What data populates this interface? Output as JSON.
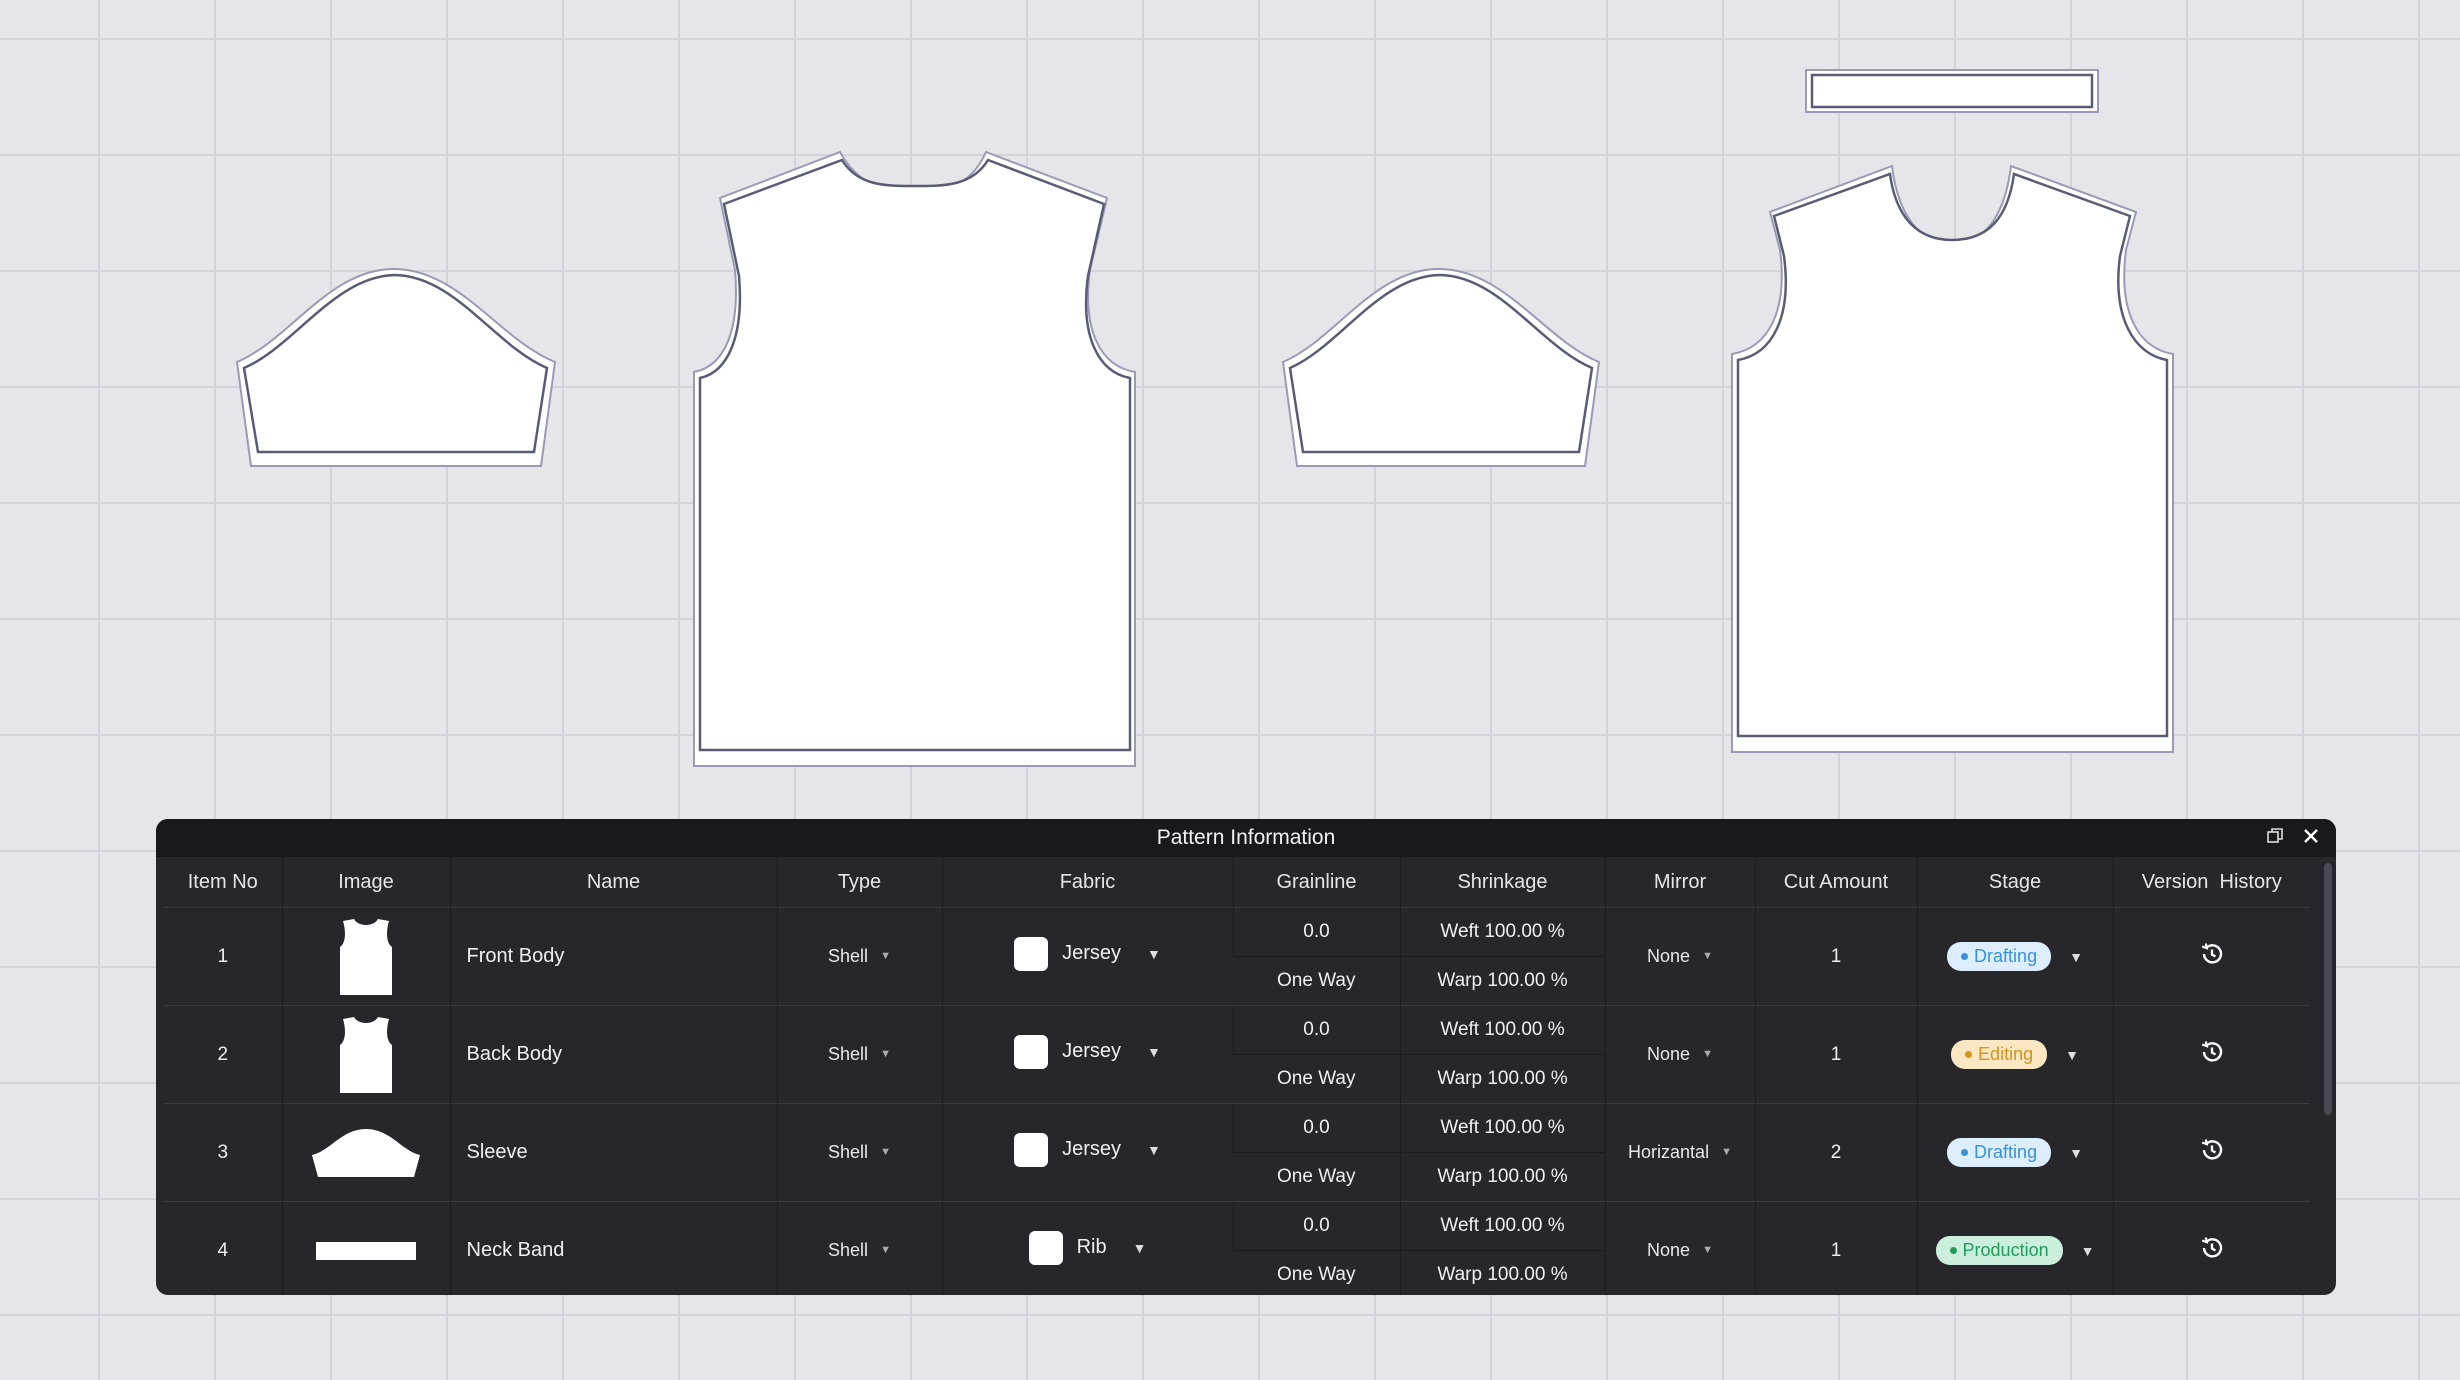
{
  "panel": {
    "title": "Pattern Information",
    "restore_icon": "restore-window-icon",
    "close_icon": "close-icon"
  },
  "columns": [
    "Item No",
    "Image",
    "Name",
    "Type",
    "Fabric",
    "Grainline",
    "Shrinkage",
    "Mirror",
    "Cut Amount",
    "Stage",
    "Version  History"
  ],
  "rows": [
    {
      "item_no": "1",
      "image": "tank-top-icon",
      "name": "Front Body",
      "type": "Shell",
      "fabric": "Jersey",
      "grain_angle": "0.0",
      "grain_dir": "One Way",
      "shrink_weft": "Weft 100.00 %",
      "shrink_warp": "Warp 100.00 %",
      "mirror": "None",
      "cut_amount": "1",
      "stage": "Drafting"
    },
    {
      "item_no": "2",
      "image": "tank-top-icon",
      "name": "Back Body",
      "type": "Shell",
      "fabric": "Jersey",
      "grain_angle": "0.0",
      "grain_dir": "One Way",
      "shrink_weft": "Weft 100.00 %",
      "shrink_warp": "Warp 100.00 %",
      "mirror": "None",
      "cut_amount": "1",
      "stage": "Editing"
    },
    {
      "item_no": "3",
      "image": "sleeve-icon",
      "name": "Sleeve",
      "type": "Shell",
      "fabric": "Jersey",
      "grain_angle": "0.0",
      "grain_dir": "One Way",
      "shrink_weft": "Weft 100.00 %",
      "shrink_warp": "Warp 100.00 %",
      "mirror": "Horizantal",
      "cut_amount": "2",
      "stage": "Drafting"
    },
    {
      "item_no": "4",
      "image": "neck-band-icon",
      "name": "Neck Band",
      "type": "Shell",
      "fabric": "Rib",
      "grain_angle": "0.0",
      "grain_dir": "One Way",
      "shrink_weft": "Weft 100.00 %",
      "shrink_warp": "Warp 100.00 %",
      "mirror": "None",
      "cut_amount": "1",
      "stage": "Production"
    }
  ],
  "stage_colors": {
    "Drafting": {
      "bg": "#dcedfb",
      "fg": "#3a92d6"
    },
    "Editing": {
      "bg": "#fbe8c2",
      "fg": "#d5921d"
    },
    "Production": {
      "bg": "#ccefdd",
      "fg": "#1f9d5c"
    }
  },
  "canvas_pieces": [
    "sleeve-piece",
    "back-body-piece",
    "sleeve-piece",
    "front-body-piece",
    "neck-band-piece"
  ]
}
